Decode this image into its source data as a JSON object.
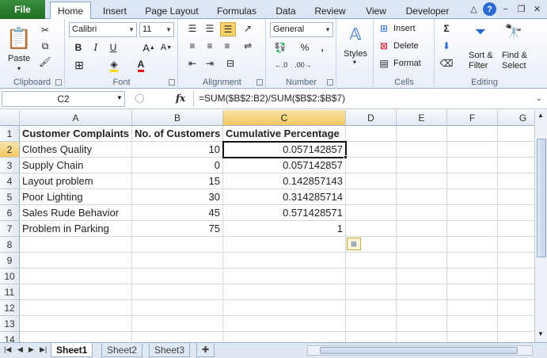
{
  "tabs": {
    "file": "File",
    "home": "Home",
    "insert": "Insert",
    "page_layout": "Page Layout",
    "formulas": "Formulas",
    "data": "Data",
    "review": "Review",
    "view": "View",
    "developer": "Developer"
  },
  "ribbon": {
    "clipboard": {
      "label": "Clipboard",
      "paste": "Paste"
    },
    "font": {
      "label": "Font",
      "family": "Calibri",
      "size": "11"
    },
    "alignment": {
      "label": "Alignment"
    },
    "number": {
      "label": "Number",
      "format": "General"
    },
    "styles": {
      "label": "Styles"
    },
    "cells": {
      "label": "Cells",
      "insert": "Insert",
      "delete": "Delete",
      "format": "Format"
    },
    "editing": {
      "label": "Editing",
      "sort": "Sort &",
      "filter": "Filter",
      "find": "Find &",
      "select": "Select"
    }
  },
  "formula_bar": {
    "name_box": "C2",
    "fx": "fx",
    "formula": "=SUM($B$2:B2)/SUM($B$2:$B$7)"
  },
  "columns": [
    "A",
    "B",
    "C",
    "D",
    "E",
    "F",
    "G"
  ],
  "rows": [
    "1",
    "2",
    "3",
    "4",
    "5",
    "6",
    "7",
    "8",
    "9",
    "10",
    "11",
    "12",
    "13",
    "14"
  ],
  "sheet": {
    "headers": [
      "Customer Complaints",
      "No. of Customers",
      "Cumulative Percentage"
    ],
    "data": [
      [
        "Clothes Quality",
        "10",
        "0.057142857"
      ],
      [
        "Supply Chain",
        "0",
        "0.057142857"
      ],
      [
        "Layout problem",
        "15",
        "0.142857143"
      ],
      [
        "Poor Lighting",
        "30",
        "0.314285714"
      ],
      [
        "Sales Rude Behavior",
        "45",
        "0.571428571"
      ],
      [
        "Problem in Parking",
        "75",
        "1"
      ]
    ]
  },
  "sheet_tabs": [
    "Sheet1",
    "Sheet2",
    "Sheet3"
  ],
  "active_sheet": "Sheet1"
}
